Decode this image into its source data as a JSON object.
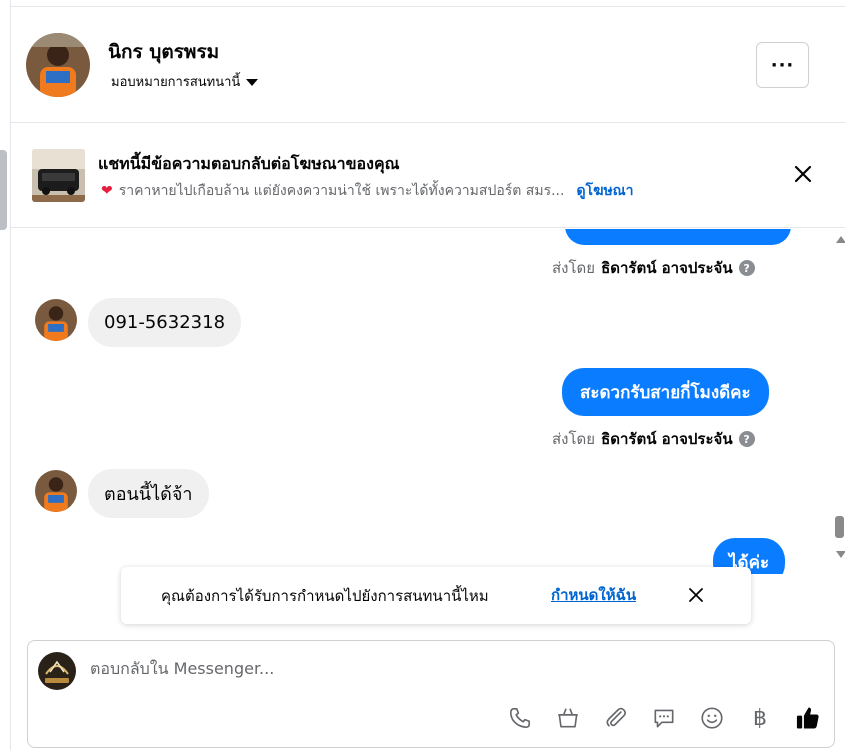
{
  "header": {
    "contact_name": "นิกร บุตรพรม",
    "assign_label": "มอบหมายการสนทนานี้",
    "more_label": "···"
  },
  "ad_banner": {
    "title": "แชทนี้มีข้อความตอบกลับต่อโฆษณาของคุณ",
    "subtitle": "ราคาหายไปเกือบล้าน แต่ยังคงความน่าใช้ เพราะได้ทั้งความสปอร์ต สมร...",
    "link_label": "ดูโฆษณา",
    "heart": "❤"
  },
  "messages": [
    {
      "direction": "outgoing",
      "text": ""
    },
    {
      "type": "sender",
      "prefix": "ส่งโดย",
      "name": "ธิดารัตน์ อาจประจัน"
    },
    {
      "direction": "incoming",
      "text": "091-5632318"
    },
    {
      "direction": "outgoing",
      "text": "สะดวกรับสายกี่โมงดีคะ"
    },
    {
      "type": "sender",
      "prefix": "ส่งโดย",
      "name": "ธิดารัตน์ อาจประจัน"
    },
    {
      "direction": "incoming",
      "text": "ตอนนี้ได้จ้า"
    },
    {
      "direction": "outgoing",
      "text": "ได้ค่ะ"
    }
  ],
  "toast": {
    "text": "คุณต้องการได้รับการกำหนดไปยังการสนทนานี้ไหม",
    "link_label": "กำหนดให้ฉัน"
  },
  "composer": {
    "placeholder": "ตอบกลับใน Messenger..."
  },
  "icons": {
    "help": "?",
    "baht": "฿"
  },
  "colors": {
    "outgoing_bubble": "#0a7cff",
    "incoming_bubble": "#f0f0f0",
    "link": "#0064d1",
    "heart": "#e41e3f"
  }
}
